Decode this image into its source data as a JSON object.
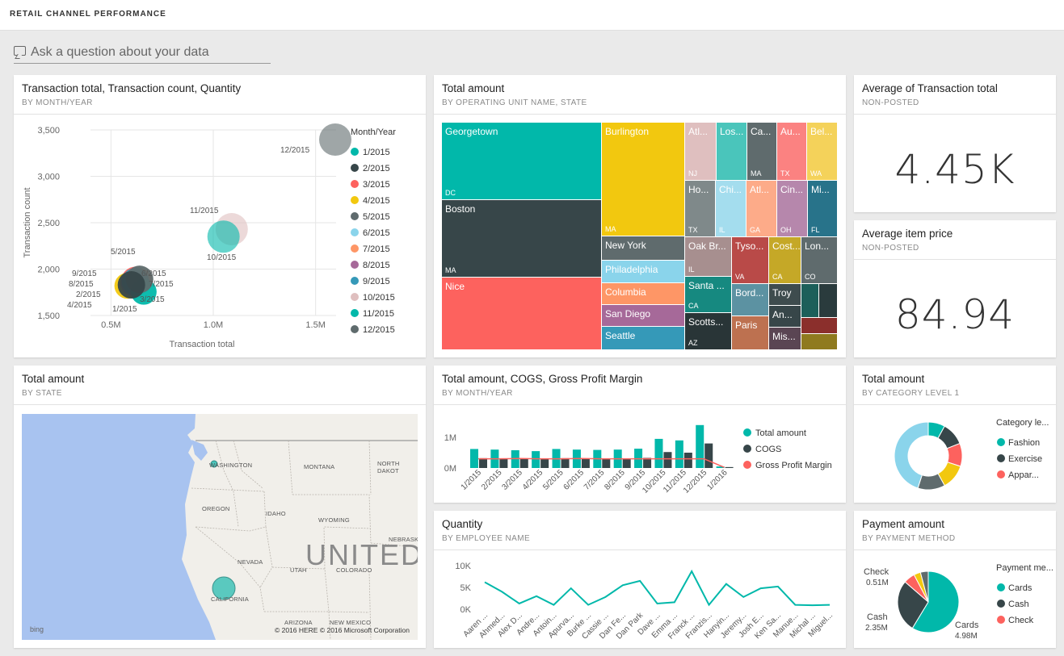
{
  "dashboard": {
    "title": "RETAIL CHANNEL PERFORMANCE"
  },
  "qa": {
    "placeholder": "Ask a question about your data"
  },
  "tiles": {
    "scatter": {
      "title": "Transaction total, Transaction count, Quantity",
      "subtitle": "BY MONTH/YEAR"
    },
    "treemap": {
      "title": "Total amount",
      "subtitle": "BY OPERATING UNIT NAME, STATE"
    },
    "avg_txn": {
      "title": "Average of Transaction total",
      "subtitle": "NON-POSTED",
      "value": "4.45K"
    },
    "avg_price": {
      "title": "Average item price",
      "subtitle": "NON-POSTED",
      "value": "84.94"
    },
    "map": {
      "title": "Total amount",
      "subtitle": "BY STATE"
    },
    "combo": {
      "title": "Total amount, COGS, Gross Profit Margin",
      "subtitle": "BY MONTH/YEAR"
    },
    "donut": {
      "title": "Total amount",
      "subtitle": "BY CATEGORY LEVEL 1"
    },
    "quantity": {
      "title": "Quantity",
      "subtitle": "BY EMPLOYEE NAME"
    },
    "payment": {
      "title": "Payment amount",
      "subtitle": "BY PAYMENT METHOD"
    }
  },
  "map": {
    "states": [
      "WASHINGTON",
      "MONTANA",
      "NORTH DAKOT",
      "OREGON",
      "IDAHO",
      "WYOMING",
      "NEBRASKA",
      "NEVADA",
      "UTAH",
      "COLORADO",
      "CALIFORNIA",
      "ARIZONA",
      "NEW MEXICO"
    ],
    "country": "UNITED",
    "bing": "bing",
    "copyright": "© 2016 HERE   © 2016 Microsoft Corporation"
  },
  "treemap": [
    {
      "name": "Georgetown",
      "state": "DC",
      "color": "#01B8AA"
    },
    {
      "name": "Boston",
      "state": "MA",
      "color": "#374649"
    },
    {
      "name": "Nice",
      "state": "",
      "color": "#FD625E"
    },
    {
      "name": "Burlington",
      "state": "MA",
      "color": "#F2C80F"
    },
    {
      "name": "New York",
      "state": "",
      "color": "#5F6B6D"
    },
    {
      "name": "Philadelphia",
      "state": "",
      "color": "#8AD4EB"
    },
    {
      "name": "Columbia",
      "state": "",
      "color": "#FE9666"
    },
    {
      "name": "San Diego",
      "state": "",
      "color": "#A66999"
    },
    {
      "name": "Seattle",
      "state": "",
      "color": "#3599B8"
    },
    {
      "name": "Atl...",
      "state": "NJ",
      "color": "#DFBFBF"
    },
    {
      "name": "Los...",
      "state": "",
      "color": "#4AC5BB"
    },
    {
      "name": "Ca...",
      "state": "MA",
      "color": "#5F6B6D"
    },
    {
      "name": "Au...",
      "state": "TX",
      "color": "#FB8281"
    },
    {
      "name": "Bel...",
      "state": "WA",
      "color": "#F4D25A"
    },
    {
      "name": "Ho...",
      "state": "TX",
      "color": "#7F898A"
    },
    {
      "name": "Chi...",
      "state": "IL",
      "color": "#A4DDEE"
    },
    {
      "name": "Atl...",
      "state": "GA",
      "color": "#FDAB89"
    },
    {
      "name": "Cin...",
      "state": "OH",
      "color": "#B687AC"
    },
    {
      "name": "Mi...",
      "state": "FL",
      "color": "#28738A"
    },
    {
      "name": "Oak Br...",
      "state": "IL",
      "color": "#A78F8F"
    },
    {
      "name": "Tyso...",
      "state": "VA",
      "color": "#B94A48"
    },
    {
      "name": "Cost...",
      "state": "CA",
      "color": "#C5A827"
    },
    {
      "name": "Lon...",
      "state": "CO",
      "color": "#5F6B6D"
    },
    {
      "name": "Santa ...",
      "state": "CA",
      "color": "#168980"
    },
    {
      "name": "Scotts...",
      "state": "AZ",
      "color": "#293537"
    },
    {
      "name": "Bord...",
      "state": "",
      "color": "#5C92A2"
    },
    {
      "name": "Troy",
      "state": "",
      "color": "#3E4C4E"
    },
    {
      "name": "Paris",
      "state": "",
      "color": "#BD7150"
    },
    {
      "name": "An...",
      "state": "",
      "color": "#374649"
    },
    {
      "name": "Mis...",
      "state": "",
      "color": "#5A4553"
    },
    {
      "name": "",
      "state": "",
      "color": "#1C5F5A"
    },
    {
      "name": "",
      "state": "",
      "color": "#2A3B3D"
    },
    {
      "name": "",
      "state": "",
      "color": "#8B2F2C"
    },
    {
      "name": "",
      "state": "",
      "color": "#8F7A1F"
    }
  ],
  "chart_data": [
    {
      "type": "scatter",
      "xlabel": "Transaction total",
      "ylabel": "Transaction count",
      "xticks": [
        "0.5M",
        "1.0M",
        "1.5M"
      ],
      "yticks": [
        "3,500",
        "3,000",
        "2,500",
        "2,000",
        "1,500"
      ],
      "xlim": [
        0.4,
        1.6
      ],
      "ylim": [
        1500,
        3500
      ],
      "legend_title": "Month/Year",
      "series": [
        {
          "name": "1/2015",
          "x": 0.66,
          "y": 1755,
          "size": 16,
          "color": "#01B8AA"
        },
        {
          "name": "2/2015",
          "x": 0.6,
          "y": 1830,
          "size": 17,
          "color": "#374649"
        },
        {
          "name": "3/2015",
          "x": 0.62,
          "y": 1870,
          "size": 18,
          "color": "#FD625E"
        },
        {
          "name": "4/2015",
          "x": 0.58,
          "y": 1820,
          "size": 16,
          "color": "#F2C80F"
        },
        {
          "name": "5/2015",
          "x": 0.64,
          "y": 1890,
          "size": 17,
          "color": "#5F6B6D"
        },
        {
          "name": "6/2015",
          "x": 0.63,
          "y": 1880,
          "size": 16,
          "color": "#8AD4EB"
        },
        {
          "name": "7/2015",
          "x": 0.64,
          "y": 1870,
          "size": 16,
          "color": "#FE9666"
        },
        {
          "name": "8/2015",
          "x": 0.61,
          "y": 1850,
          "size": 16,
          "color": "#A66999"
        },
        {
          "name": "9/2015",
          "x": 0.62,
          "y": 1865,
          "size": 17,
          "color": "#3599B8"
        },
        {
          "name": "10/2015",
          "x": 1.09,
          "y": 2430,
          "size": 20,
          "color": "#DFBFBF"
        },
        {
          "name": "11/2015",
          "x": 1.05,
          "y": 2350,
          "size": 20,
          "color": "#01B8AA"
        },
        {
          "name": "12/2015",
          "x": 1.55,
          "y": 3500,
          "size": 20,
          "color": "#5F6B6D"
        }
      ],
      "point_labels": [
        "12/2015",
        "11/2015",
        "10/2015",
        "5/2015",
        "9/2015",
        "6/2015",
        "8/2015",
        "7/2015",
        "2/2015",
        "3/2015",
        "4/2015",
        "1/2015"
      ]
    },
    {
      "type": "bar",
      "categories": [
        "1/2015",
        "2/2015",
        "3/2015",
        "4/2015",
        "5/2015",
        "6/2015",
        "7/2015",
        "8/2015",
        "9/2015",
        "10/2015",
        "11/2015",
        "12/2015",
        "1/2016"
      ],
      "yticks": [
        "1M",
        "0M"
      ],
      "ylim": [
        0,
        1.5
      ],
      "series": [
        {
          "name": "Total amount",
          "color": "#01B8AA",
          "values": [
            0.62,
            0.6,
            0.58,
            0.55,
            0.62,
            0.6,
            0.59,
            0.6,
            0.63,
            0.95,
            0.9,
            1.4,
            0.05
          ]
        },
        {
          "name": "COGS",
          "color": "#374649",
          "values": [
            0.32,
            0.31,
            0.3,
            0.29,
            0.32,
            0.31,
            0.31,
            0.31,
            0.33,
            0.52,
            0.5,
            0.8,
            0.03
          ]
        },
        {
          "name": "Gross Profit Margin",
          "color": "#FD625E",
          "type": "line",
          "values": [
            0.3,
            0.3,
            0.31,
            0.3,
            0.3,
            0.31,
            0.3,
            0.3,
            0.3,
            0.3,
            0.3,
            0.3,
            0.02
          ]
        }
      ]
    },
    {
      "type": "pie",
      "donut": true,
      "legend_title": "Category le...",
      "labels": [
        "Fashion",
        "Exercise",
        "Appar..."
      ],
      "colors": [
        "#01B8AA",
        "#374649",
        "#FD625E",
        "#F2C80F",
        "#5F6B6D",
        "#8AD4EB"
      ],
      "values": [
        8,
        11,
        11,
        12,
        13,
        45
      ]
    },
    {
      "type": "line",
      "categories": [
        "Aaren ...",
        "Ahmed...",
        "Alex D...",
        "Andre...",
        "Antoin...",
        "Apurva...",
        "Burke ...",
        "Cassie ...",
        "Dan Fe...",
        "Dan Park",
        "Dave ...",
        "Emma ...",
        "Franck ...",
        "Franzis...",
        "Hanyin...",
        "Jeremy...",
        "Josh E...",
        "Ken Sa...",
        "Manue...",
        "Michal ...",
        "Miguel..."
      ],
      "yticks": [
        "10K",
        "5K",
        "0K"
      ],
      "ylim": [
        0,
        10
      ],
      "series": [
        {
          "name": "Quantity",
          "color": "#01B8AA",
          "values": [
            6.2,
            4.0,
            1.3,
            3.0,
            1.0,
            4.8,
            1.0,
            2.8,
            5.5,
            6.5,
            1.3,
            1.6,
            8.7,
            1.0,
            5.8,
            2.8,
            4.8,
            5.2,
            1.0,
            0.9,
            1.0
          ]
        }
      ]
    },
    {
      "type": "pie",
      "legend_title": "Payment me...",
      "labels": [
        "Cards",
        "Cash",
        "Check"
      ],
      "colors": [
        "#01B8AA",
        "#374649",
        "#FD625E",
        "#F2C80F",
        "#5F6B6D"
      ],
      "values": [
        4.98,
        2.35,
        0.51,
        0.3,
        0.35
      ],
      "data_labels": [
        {
          "name": "Cards",
          "value": "4.98M"
        },
        {
          "name": "Cash",
          "value": "2.35M"
        },
        {
          "name": "Check",
          "value": "0.51M"
        }
      ]
    }
  ]
}
